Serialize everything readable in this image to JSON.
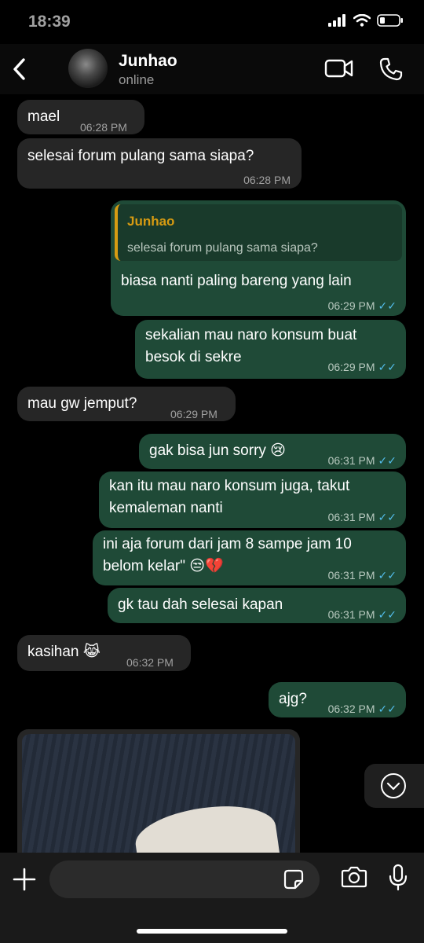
{
  "status": {
    "time": "18:39"
  },
  "header": {
    "name": "Junhao",
    "status": "online"
  },
  "messages": [
    {
      "text": "mael",
      "time": "06:28 PM"
    },
    {
      "text": "selesai forum pulang sama siapa?",
      "time": "06:28 PM"
    },
    {
      "reply_name": "Junhao",
      "reply_text": "selesai forum pulang sama siapa?",
      "text": "biasa nanti paling bareng yang lain",
      "time": "06:29 PM"
    },
    {
      "line1": "sekalian mau naro konsum buat",
      "line2": "besok di sekre",
      "time": "06:29 PM"
    },
    {
      "text": "mau gw jemput?",
      "time": "06:29 PM"
    },
    {
      "text": "gak bisa jun sorry 😢",
      "time": "06:31 PM"
    },
    {
      "line1": "kan itu mau naro konsum juga, takut",
      "line2": "kemaleman nanti",
      "time": "06:31 PM"
    },
    {
      "line1": "ini aja forum dari jam 8 sampe jam 10",
      "line2": "belom kelar\" 😒💔",
      "time": "06:31 PM"
    },
    {
      "text": "gk tau dah selesai kapan",
      "time": "06:31 PM"
    },
    {
      "text": "kasihan 😹",
      "time": "06:32 PM"
    },
    {
      "text": "ajg?",
      "time": "06:32 PM"
    }
  ],
  "colors": {
    "incoming": "#262626",
    "outgoing": "#1f4a37",
    "reply_accent": "#d79b12",
    "read_ticks": "#53bdeb"
  },
  "icons": [
    "back-arrow-icon",
    "video-call-icon",
    "phone-icon",
    "chevron-down-icon",
    "plus-icon",
    "sticker-icon",
    "camera-icon",
    "microphone-icon"
  ]
}
